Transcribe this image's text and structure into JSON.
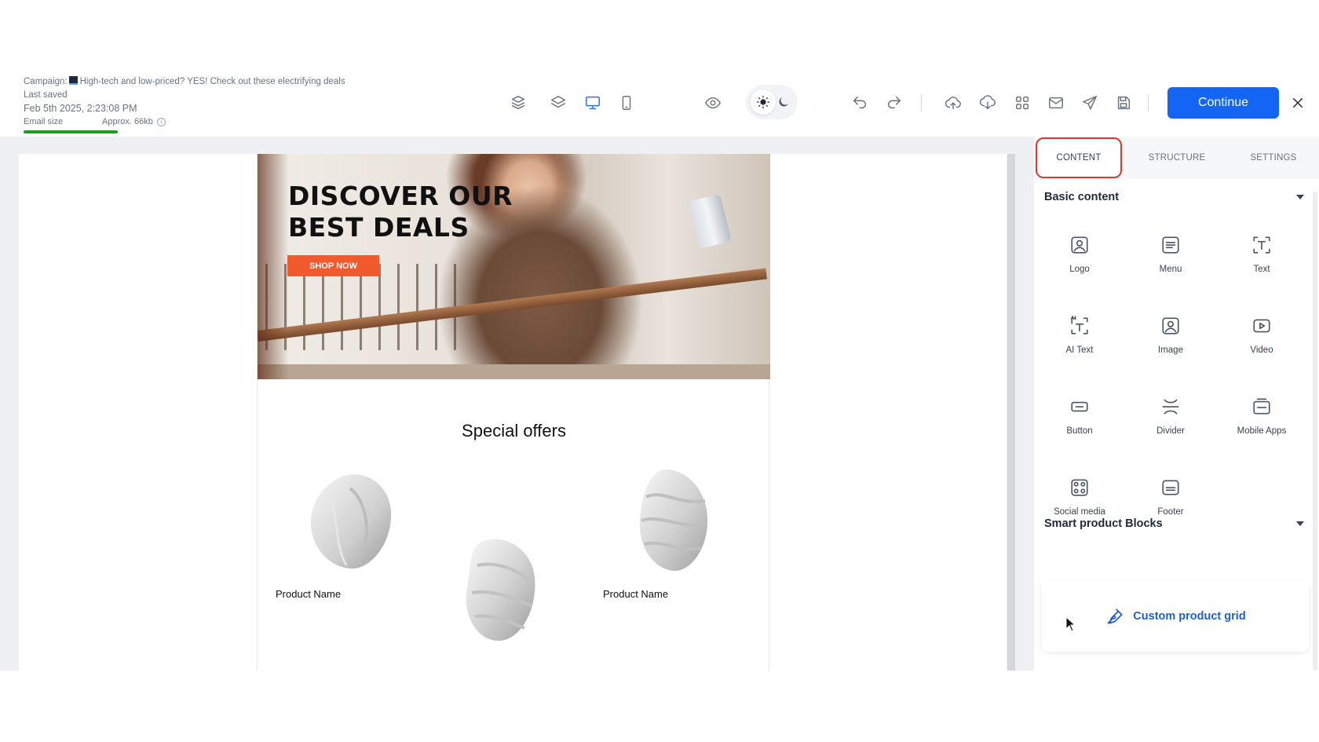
{
  "header": {
    "campaign_prefix": "Campaign:",
    "campaign_title": "High-tech and low-priced? YES! Check out these electrifying deals",
    "last_saved_label": "Last saved",
    "last_saved_date": "Feb 5th 2025, 2:23:08 PM",
    "email_size_label": "Email size",
    "email_size_value": "Approx. 66kb",
    "email_size_progress": 0.12,
    "continue_label": "Continue"
  },
  "toolbar": {
    "icons": [
      "stack-icon",
      "layers-icon",
      "desktop-preview-icon",
      "mobile-preview-icon",
      "preview-eye-icon",
      "light-mode-icon",
      "dark-mode-icon",
      "undo-icon",
      "redo-icon",
      "upload-icon",
      "download-icon",
      "grid-icon",
      "mail-icon",
      "send-icon",
      "save-icon",
      "close-icon"
    ],
    "accent_color": "#1565f5"
  },
  "email": {
    "hero_title": "DISCOVER OUR BEST DEALS",
    "shop_now": "SHOP NOW",
    "offers_title": "Special offers",
    "products": [
      {
        "name": "Product Name"
      },
      {
        "name": "Product Name"
      }
    ]
  },
  "panel": {
    "tabs": [
      "CONTENT",
      "STRUCTURE",
      "SETTINGS"
    ],
    "active_tab": "CONTENT",
    "basic_content_title": "Basic content",
    "basic_items": [
      "Logo",
      "Menu",
      "Text",
      "AI Text",
      "Image",
      "Video",
      "Button",
      "Divider",
      "Mobile Apps",
      "Social media",
      "Footer"
    ],
    "smart_title": "Smart product Blocks",
    "custom_grid_label": "Custom product grid"
  }
}
